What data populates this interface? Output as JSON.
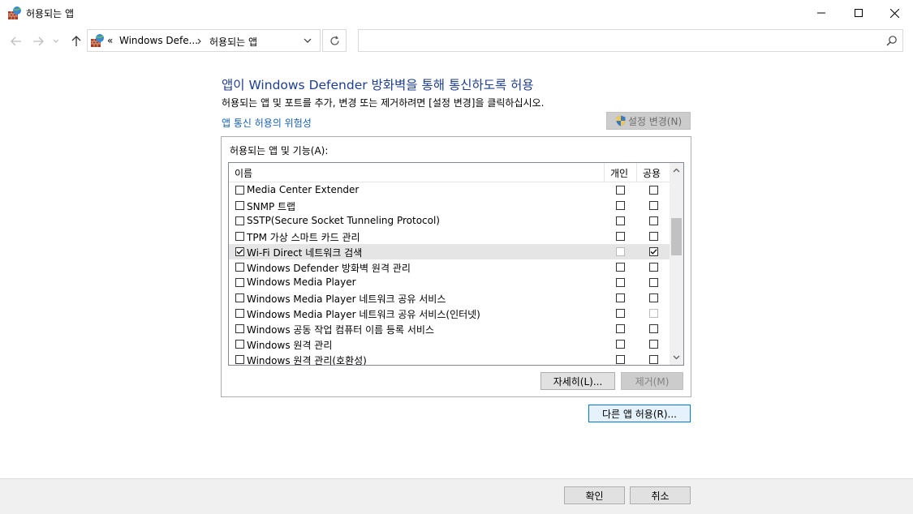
{
  "window": {
    "title": "허용되는 앱"
  },
  "address": {
    "chevrons": "«",
    "seg1": "Windows Defe...",
    "seg2": "허용되는 앱"
  },
  "search": {
    "placeholder": ""
  },
  "content": {
    "heading": "앱이 Windows Defender 방화벽을 통해 통신하도록 허용",
    "subtext": "허용되는 앱 및 포트를 추가, 변경 또는 제거하려면 [설정 변경]을 클릭하십시오.",
    "risk_link": "앱 통신 허용의 위험성",
    "change_settings": "설정 변경(N)",
    "group_label": "허용되는 앱 및 기능(A):",
    "columns": {
      "name": "이름",
      "private": "개인",
      "public": "공용"
    },
    "rows": [
      {
        "name": "Media Center Extender",
        "enabled": false,
        "private": false,
        "public": false,
        "private_disabled": false,
        "public_disabled": false
      },
      {
        "name": "SNMP 트랩",
        "enabled": false,
        "private": false,
        "public": false,
        "private_disabled": false,
        "public_disabled": false
      },
      {
        "name": "SSTP(Secure Socket Tunneling Protocol)",
        "enabled": false,
        "private": false,
        "public": false,
        "private_disabled": false,
        "public_disabled": false
      },
      {
        "name": "TPM 가상 스마트 카드 관리",
        "enabled": false,
        "private": false,
        "public": false,
        "private_disabled": false,
        "public_disabled": false
      },
      {
        "name": "Wi-Fi Direct 네트워크 검색",
        "enabled": true,
        "private": false,
        "public": true,
        "private_disabled": true,
        "public_disabled": false,
        "highlighted": true
      },
      {
        "name": "Windows Defender 방화벽 원격 관리",
        "enabled": false,
        "private": false,
        "public": false,
        "private_disabled": false,
        "public_disabled": false
      },
      {
        "name": "Windows Media Player",
        "enabled": false,
        "private": false,
        "public": false,
        "private_disabled": false,
        "public_disabled": false
      },
      {
        "name": "Windows Media Player 네트워크 공유 서비스",
        "enabled": false,
        "private": false,
        "public": false,
        "private_disabled": false,
        "public_disabled": false
      },
      {
        "name": "Windows Media Player 네트워크 공유 서비스(인터넷)",
        "enabled": false,
        "private": false,
        "public": false,
        "private_disabled": false,
        "public_disabled": true
      },
      {
        "name": "Windows 공동 작업 컴퓨터 이름 등록 서비스",
        "enabled": false,
        "private": false,
        "public": false,
        "private_disabled": false,
        "public_disabled": false
      },
      {
        "name": "Windows 원격 관리",
        "enabled": false,
        "private": false,
        "public": false,
        "private_disabled": false,
        "public_disabled": false
      },
      {
        "name": "Windows 원격 관리(호환성)",
        "enabled": false,
        "private": false,
        "public": false,
        "private_disabled": false,
        "public_disabled": false
      }
    ],
    "details_btn": "자세히(L)...",
    "remove_btn": "제거(M)",
    "allow_other_btn": "다른 앱 허용(R)..."
  },
  "footer": {
    "ok": "확인",
    "cancel": "취소"
  }
}
